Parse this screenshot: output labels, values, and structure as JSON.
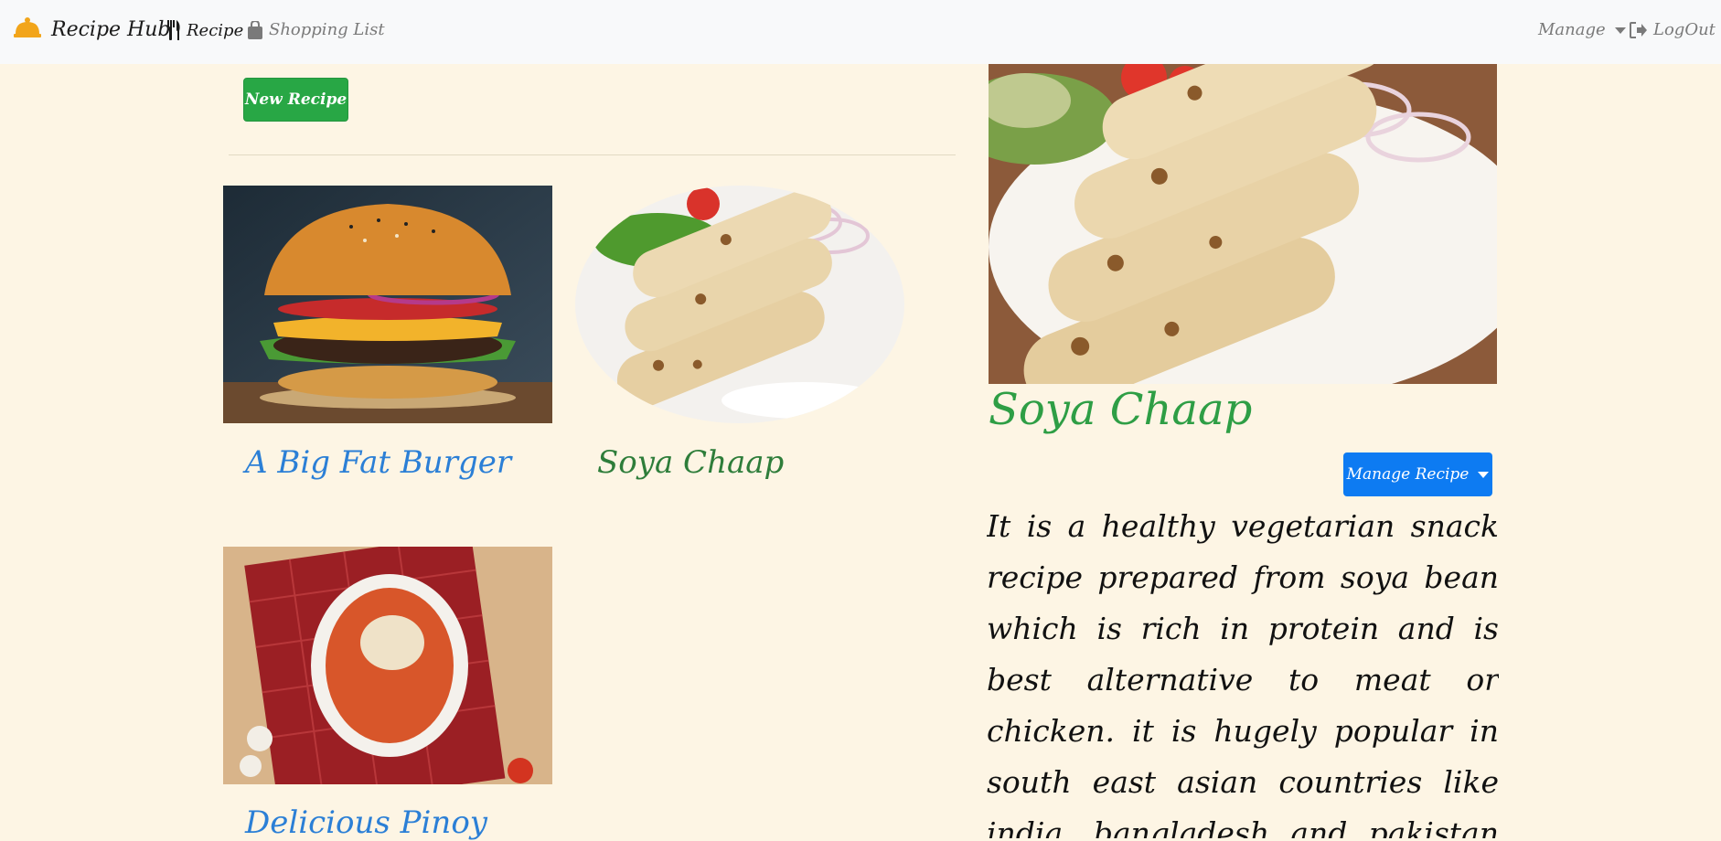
{
  "navbar": {
    "brand": "Recipe Hub",
    "brand_icon": "cloche-icon",
    "recipe_label": "Recipe",
    "shopping_label": "Shopping List",
    "manage_label": "Manage",
    "logout_label": "LogOut"
  },
  "toolbar": {
    "new_recipe_label": "New Recipe"
  },
  "recipes": [
    {
      "title": "A Big Fat Burger",
      "image": "burger-photo"
    },
    {
      "title": "Soya Chaap",
      "image": "soya-chaap-photo",
      "selected": true
    },
    {
      "title": "Delicious Pinoy",
      "image": "spaghetti-photo"
    }
  ],
  "detail": {
    "title": "Soya Chaap",
    "manage_label": "Manage Recipe",
    "description": "It is a healthy vegetarian snack recipe prepared from soya bean which is rich in protein and is best alternative to meat or chicken. it is hugely popular in south east asian countries like india, bangladesh and pakistan and is typically prepared with skewers in"
  },
  "colors": {
    "background": "#fdf5e4",
    "navbar": "#f8f9fa",
    "success": "#28a745",
    "primary": "#0d7bf2",
    "link_blue": "#2b7fd6",
    "title_green": "#2e9e45"
  }
}
